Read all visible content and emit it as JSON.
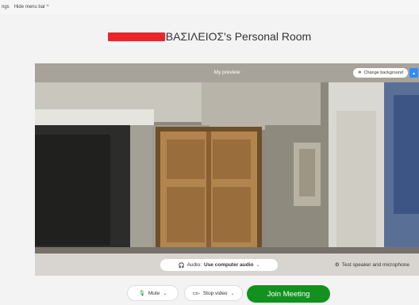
{
  "menubar": {
    "truncated_left": "ngs",
    "hide_label": "Hide menu bar"
  },
  "room": {
    "name_suffix": "ΒΑΣΙΛΕΙΟΣ's Personal Room"
  },
  "preview": {
    "label": "My preview",
    "change_background": "Change background"
  },
  "audio": {
    "prefix": "Audio:",
    "value": "Use computer audio"
  },
  "test_speaker": "Test speaker and microphone",
  "controls": {
    "mute": "Mute",
    "stop_video": "Stop video",
    "join": "Join Meeting"
  },
  "colors": {
    "join_green": "#12911f",
    "accent_blue": "#2d8cff",
    "redaction_red": "#e8272a"
  }
}
